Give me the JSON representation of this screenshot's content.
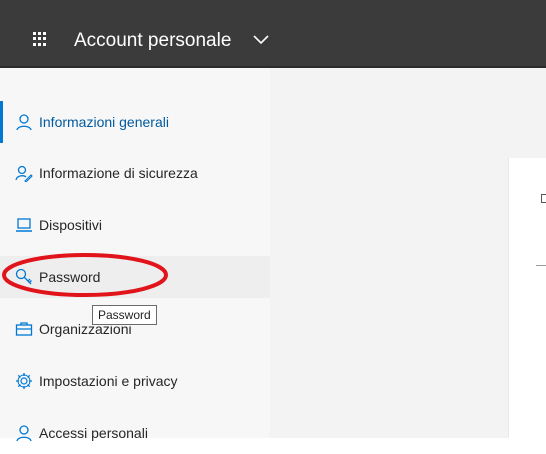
{
  "header": {
    "app_launcher_icon": "waffle-icon",
    "title": "Account personale",
    "chevron_icon": "chevron-down-icon"
  },
  "sidebar": {
    "items": [
      {
        "label": "Informazioni generali",
        "icon": "person-icon",
        "active": true
      },
      {
        "label": "Informazione di sicurezza",
        "icon": "security-info-icon"
      },
      {
        "label": "Dispositivi",
        "icon": "laptop-icon"
      },
      {
        "label": "Password",
        "icon": "key-icon",
        "hovered": true
      },
      {
        "label": "Organizzazioni",
        "icon": "briefcase-icon"
      },
      {
        "label": "Impostazioni e privacy",
        "icon": "gear-icon"
      },
      {
        "label": "Accessi personali",
        "icon": "person-icon"
      }
    ]
  },
  "tooltip": {
    "text": "Password"
  },
  "annotation": {
    "shape": "circle",
    "color": "#e0141a",
    "target": "Password"
  },
  "colors": {
    "topbar": "#3b3b3b",
    "sidebar": "#f7f7f7",
    "accent": "#0078d4",
    "active_text": "#005a9e"
  }
}
